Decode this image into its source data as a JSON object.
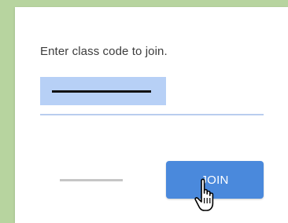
{
  "dialog": {
    "prompt": "Enter class code to join.",
    "join_label": "JOIN",
    "cursor_icon": "hand-pointer-icon"
  },
  "colors": {
    "background": "#b7d49f",
    "card": "#ffffff",
    "field_highlight": "#b7d0f6",
    "underline": "#b9cdee",
    "join_button": "#4a89dc",
    "cancel_bar": "#c6c6c6"
  }
}
